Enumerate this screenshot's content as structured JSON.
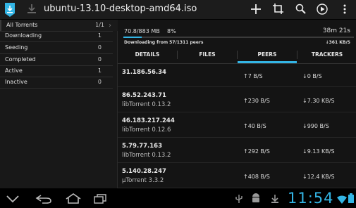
{
  "actionbar": {
    "title": "ubuntu-13.10-desktop-amd64.iso",
    "icons": [
      "app-icon",
      "download-icon",
      "add-icon",
      "crop-icon",
      "search-icon",
      "play-icon",
      "overflow-icon"
    ]
  },
  "sidebar": {
    "page_indicator": "1/1",
    "items": [
      {
        "label": "All Torrents",
        "count": ""
      },
      {
        "label": "Downloading",
        "count": "1"
      },
      {
        "label": "Seeding",
        "count": "0"
      },
      {
        "label": "Completed",
        "count": "0"
      },
      {
        "label": "Active",
        "count": "1"
      },
      {
        "label": "Inactive",
        "count": "0"
      }
    ]
  },
  "torrent": {
    "size_progress": "70.8/883 MB",
    "percent_text": "8%",
    "progress_fraction": 0.08,
    "eta": "38m 21s",
    "status": "Downloading from 57/1311 peers",
    "rate": "↓361 KB/S"
  },
  "tabs": [
    "DETAILS",
    "FILES",
    "PEERS",
    "TRACKERS"
  ],
  "active_tab": "PEERS",
  "peers": [
    {
      "ip": "31.186.56.34",
      "client": "",
      "up": "↑7 B/S",
      "down": "↓0 B/S"
    },
    {
      "ip": "86.52.243.71",
      "client": "libTorrent 0.13.2",
      "up": "↑230 B/S",
      "down": "↓7.30 KB/S"
    },
    {
      "ip": "46.183.217.244",
      "client": "libTorrent 0.12.6",
      "up": "↑40 B/S",
      "down": "↓990 B/S"
    },
    {
      "ip": "5.79.77.163",
      "client": "libTorrent 0.13.2",
      "up": "↑292 B/S",
      "down": "↓9.13 KB/S"
    },
    {
      "ip": "5.140.28.247",
      "client": "µTorrent 3.3.2",
      "up": "↑408 B/S",
      "down": "↓12.4 KB/S"
    }
  ],
  "navbar": {
    "clock": "11:54",
    "accent": "#33b5e5"
  }
}
